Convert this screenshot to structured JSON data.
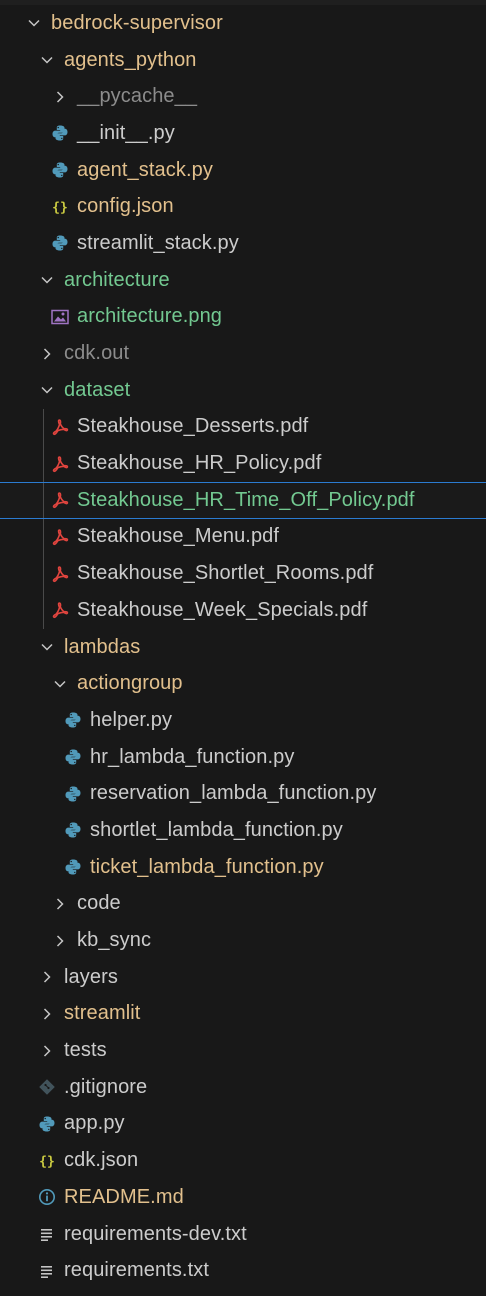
{
  "explorer": {
    "root": {
      "label": "bedrock-supervisor"
    },
    "agents_python": {
      "label": "agents_python",
      "pycache": "__pycache__",
      "init": "__init__.py",
      "agent_stack": "agent_stack.py",
      "config": "config.json",
      "streamlit_stack": "streamlit_stack.py"
    },
    "architecture": {
      "label": "architecture",
      "png": "architecture.png"
    },
    "cdk_out": "cdk.out",
    "dataset": {
      "label": "dataset",
      "files": [
        "Steakhouse_Desserts.pdf",
        "Steakhouse_HR_Policy.pdf",
        "Steakhouse_HR_Time_Off_Policy.pdf",
        "Steakhouse_Menu.pdf",
        "Steakhouse_Shortlet_Rooms.pdf",
        "Steakhouse_Week_Specials.pdf"
      ]
    },
    "lambdas": {
      "label": "lambdas",
      "actiongroup": {
        "label": "actiongroup",
        "files": [
          "helper.py",
          "hr_lambda_function.py",
          "reservation_lambda_function.py",
          "shortlet_lambda_function.py",
          "ticket_lambda_function.py"
        ]
      },
      "code": "code",
      "kb_sync": "kb_sync"
    },
    "layers": "layers",
    "streamlit": "streamlit",
    "tests": "tests",
    "files": {
      "gitignore": ".gitignore",
      "app": "app.py",
      "cdk_json": "cdk.json",
      "readme": "README.md",
      "req_dev": "requirements-dev.txt",
      "req": "requirements.txt"
    }
  },
  "colors": {
    "background": "#181818",
    "text": "#cccccc",
    "modified": "#e2c08d",
    "untracked": "#73c991",
    "pdf_icon": "#e0443e",
    "python_icon": "#519aba",
    "json_icon": "#cbcb41",
    "selection_border": "#2b7bd0"
  }
}
